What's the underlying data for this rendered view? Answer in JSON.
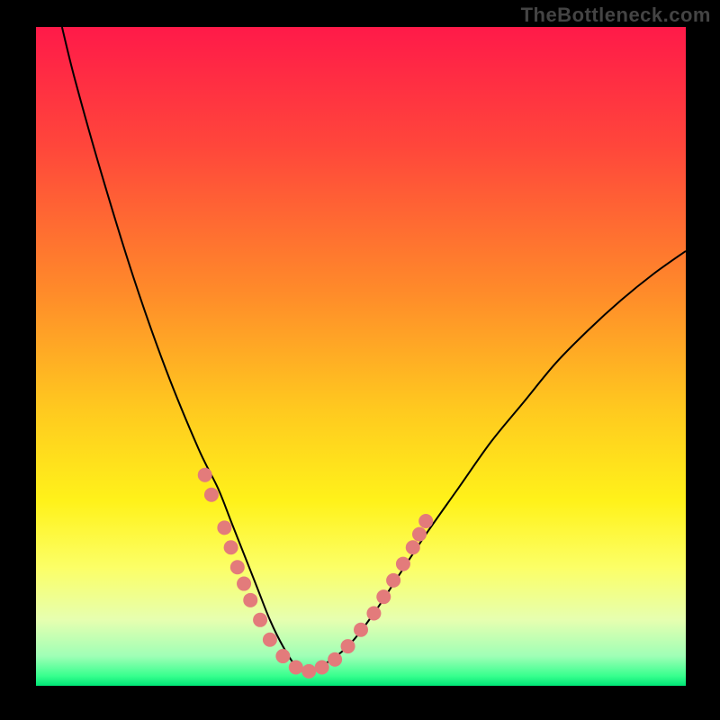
{
  "watermark": "TheBottleneck.com",
  "chart_data": {
    "type": "line",
    "title": "",
    "xlabel": "",
    "ylabel": "",
    "xlim": [
      0,
      100
    ],
    "ylim": [
      0,
      100
    ],
    "grid": false,
    "series": [
      {
        "name": "main-curve",
        "color": "#000000",
        "x": [
          4,
          6,
          10,
          15,
          20,
          25,
          28,
          30,
          32,
          34,
          36,
          38,
          40,
          42,
          44,
          48,
          52,
          56,
          60,
          65,
          70,
          75,
          80,
          85,
          90,
          95,
          100
        ],
        "values": [
          100,
          92,
          78,
          62,
          48,
          36,
          30,
          25,
          20,
          15,
          10,
          6,
          3,
          2,
          3,
          6,
          11,
          17,
          23,
          30,
          37,
          43,
          49,
          54,
          58.5,
          62.5,
          66
        ]
      }
    ],
    "markers": {
      "name": "highlight-dots",
      "color": "#e37b7b",
      "radius_px": 8,
      "points": [
        {
          "x": 26,
          "y": 32
        },
        {
          "x": 27,
          "y": 29
        },
        {
          "x": 29,
          "y": 24
        },
        {
          "x": 30,
          "y": 21
        },
        {
          "x": 31,
          "y": 18
        },
        {
          "x": 32,
          "y": 15.5
        },
        {
          "x": 33,
          "y": 13
        },
        {
          "x": 34.5,
          "y": 10
        },
        {
          "x": 36,
          "y": 7
        },
        {
          "x": 38,
          "y": 4.5
        },
        {
          "x": 40,
          "y": 2.8
        },
        {
          "x": 42,
          "y": 2.2
        },
        {
          "x": 44,
          "y": 2.8
        },
        {
          "x": 46,
          "y": 4
        },
        {
          "x": 48,
          "y": 6
        },
        {
          "x": 50,
          "y": 8.5
        },
        {
          "x": 52,
          "y": 11
        },
        {
          "x": 53.5,
          "y": 13.5
        },
        {
          "x": 55,
          "y": 16
        },
        {
          "x": 56.5,
          "y": 18.5
        },
        {
          "x": 58,
          "y": 21
        },
        {
          "x": 59,
          "y": 23
        },
        {
          "x": 60,
          "y": 25
        }
      ]
    },
    "background": {
      "type": "vertical-gradient",
      "stops": [
        {
          "pos": 0.0,
          "color": "#ff1a49"
        },
        {
          "pos": 0.18,
          "color": "#ff463b"
        },
        {
          "pos": 0.4,
          "color": "#ff8a2a"
        },
        {
          "pos": 0.58,
          "color": "#ffc91f"
        },
        {
          "pos": 0.72,
          "color": "#fff21a"
        },
        {
          "pos": 0.82,
          "color": "#fcff66"
        },
        {
          "pos": 0.9,
          "color": "#e6ffb0"
        },
        {
          "pos": 0.955,
          "color": "#9fffb6"
        },
        {
          "pos": 0.985,
          "color": "#38ff8e"
        },
        {
          "pos": 1.0,
          "color": "#00e676"
        }
      ]
    }
  }
}
